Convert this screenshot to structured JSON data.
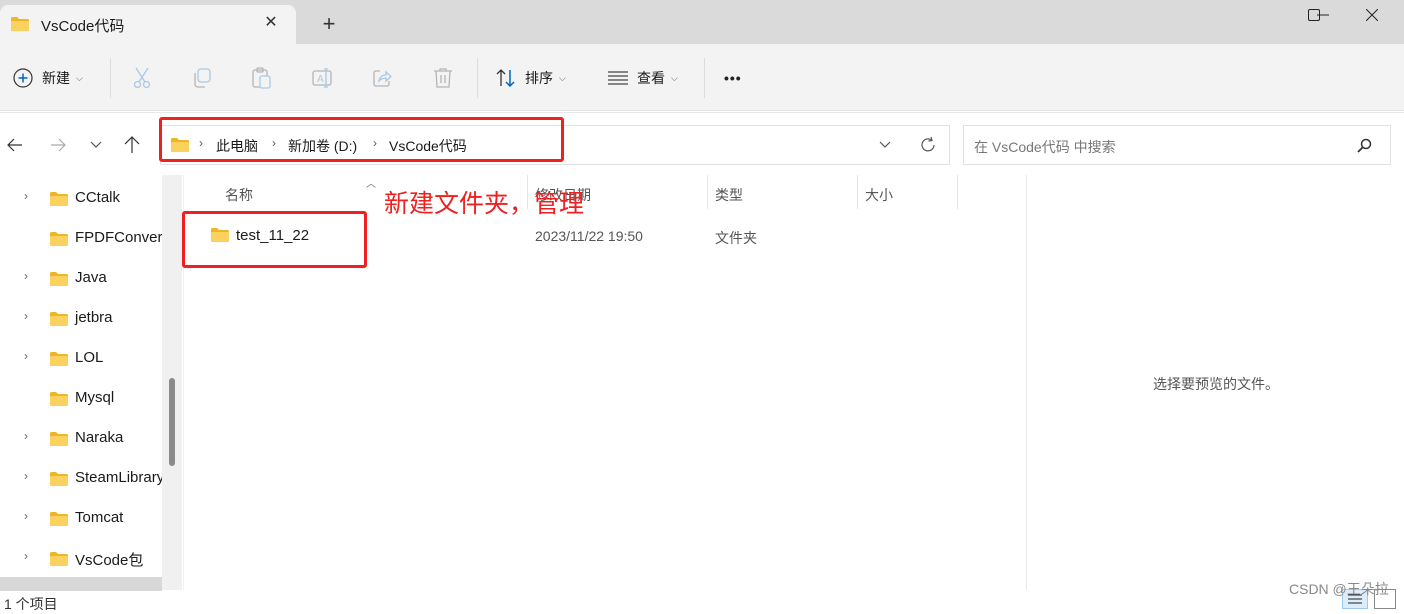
{
  "window": {
    "tab_title": "VsCode代码",
    "tab_close_icon": "close-icon",
    "new_tab_icon": "plus-icon",
    "controls": [
      "minimize",
      "maximize",
      "close"
    ]
  },
  "toolbar": {
    "new_label": "新建",
    "sort_label": "排序",
    "view_label": "查看",
    "more_label": "•••",
    "icons": [
      "cut-icon",
      "copy-icon",
      "paste-icon",
      "rename-icon",
      "share-icon",
      "delete-icon"
    ]
  },
  "address": {
    "crumbs": [
      "此电脑",
      "新加卷 (D:)",
      "VsCode代码"
    ],
    "search_placeholder": "在 VsCode代码 中搜索"
  },
  "sidebar": {
    "items": [
      {
        "label": "CCtalk",
        "expandable": true
      },
      {
        "label": "FPDFConverter",
        "expandable": false
      },
      {
        "label": "Java",
        "expandable": true
      },
      {
        "label": "jetbra",
        "expandable": true
      },
      {
        "label": "LOL",
        "expandable": true
      },
      {
        "label": "Mysql",
        "expandable": false
      },
      {
        "label": "Naraka",
        "expandable": true
      },
      {
        "label": "SteamLibrary",
        "expandable": true
      },
      {
        "label": "Tomcat",
        "expandable": true
      },
      {
        "label": "VsCode包",
        "expandable": true
      }
    ]
  },
  "filelist": {
    "columns": [
      "名称",
      "修改日期",
      "类型",
      "大小"
    ],
    "rows": [
      {
        "name": "test_11_22",
        "modified": "2023/11/22 19:50",
        "type": "文件夹",
        "size": ""
      }
    ]
  },
  "preview": {
    "empty_text": "选择要预览的文件。"
  },
  "status": {
    "item_count": "1 个项目"
  },
  "annotation": {
    "text": "新建文件夹，管理",
    "color": "#f02020"
  },
  "watermark": "CSDN @王朵拉",
  "colors": {
    "folder": "#f8c443",
    "accent": "#0067c0"
  }
}
